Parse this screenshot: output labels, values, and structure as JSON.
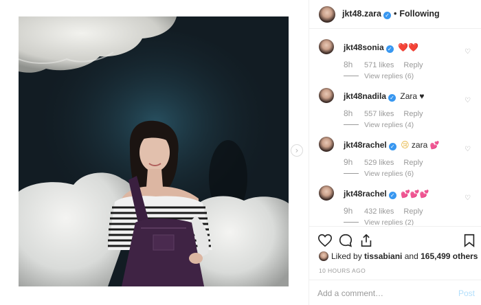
{
  "post": {
    "username": "jkt48.zara",
    "verified_badge": "✓",
    "separator": "•",
    "follow_state": "Following"
  },
  "comments": [
    {
      "username": "jkt48sonia",
      "text": "",
      "emoji": "❤️❤️",
      "time": "8h",
      "likes": "571 likes",
      "reply": "Reply",
      "view_replies": "View replies (6)"
    },
    {
      "username": "jkt48nadila",
      "text": "Zara ♥",
      "emoji": "",
      "time": "8h",
      "likes": "557 likes",
      "reply": "Reply",
      "view_replies": "View replies (4)"
    },
    {
      "username": "jkt48rachel",
      "text": "zara",
      "emoji": "😢",
      "emoji_after": "💕",
      "time": "9h",
      "likes": "529 likes",
      "reply": "Reply",
      "view_replies": "View replies (6)"
    },
    {
      "username": "jkt48rachel",
      "text": "",
      "emoji": "💕💕💕",
      "time": "9h",
      "likes": "432 likes",
      "reply": "Reply",
      "view_replies": "View replies (2)"
    }
  ],
  "actions": {
    "like_icon": "heart-outline-icon",
    "comment_icon": "comment-bubble-icon",
    "share_icon": "share-upload-icon",
    "save_icon": "bookmark-icon"
  },
  "likes_summary": {
    "prefix": "Liked by ",
    "user": "tissabiani",
    "middle": " and ",
    "count": "165,499 others"
  },
  "time_ago": "10 HOURS AGO",
  "add_comment": {
    "placeholder": "Add a comment…",
    "post_label": "Post"
  },
  "colors": {
    "verified": "#3897f0",
    "post_disabled": "#b2dffc",
    "muted": "#999999"
  }
}
